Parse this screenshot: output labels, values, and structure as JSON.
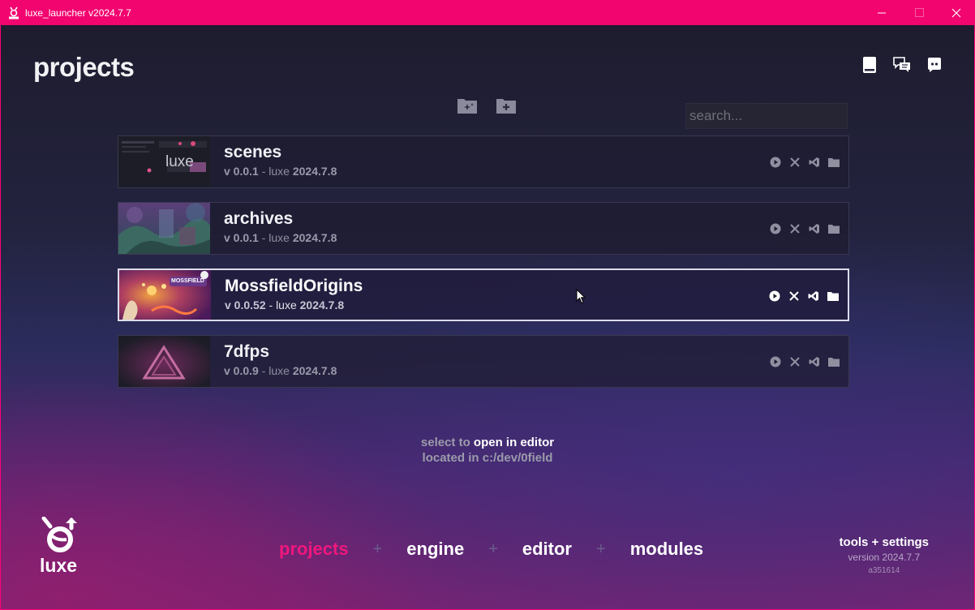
{
  "window": {
    "title": "luxe_launcher v2024.7.7",
    "minimize": "—",
    "maximize": "☐",
    "close": "✕"
  },
  "page": {
    "title": "projects"
  },
  "search": {
    "placeholder": "search..."
  },
  "projects": [
    {
      "name": "scenes",
      "version": "v 0.0.1",
      "engine_label": "luxe",
      "engine_version": "2024.7.8",
      "thumb_text": "luxe"
    },
    {
      "name": "archives",
      "version": "v 0.0.1",
      "engine_label": "luxe",
      "engine_version": "2024.7.8"
    },
    {
      "name": "MossfieldOrigins",
      "version": "v 0.0.52",
      "engine_label": "luxe",
      "engine_version": "2024.7.8",
      "selected": true,
      "thumb_text": "MOSSFIELD"
    },
    {
      "name": "7dfps",
      "version": "v 0.0.9",
      "engine_label": "luxe",
      "engine_version": "2024.7.8"
    }
  ],
  "hint": {
    "line1_prefix": "select to",
    "line1_action": "open in editor",
    "line2_prefix": "located in",
    "line2_path": "c:/dev/0field"
  },
  "nav": {
    "projects": "projects",
    "engine": "engine",
    "editor": "editor",
    "modules": "modules",
    "separator": "+"
  },
  "logo": {
    "text": "luxe"
  },
  "tools": {
    "label": "tools + settings",
    "version": "version 2024.7.7",
    "hash": "a351614"
  },
  "colors": {
    "accent": "#f0177d",
    "titlebar": "#f2056f"
  }
}
